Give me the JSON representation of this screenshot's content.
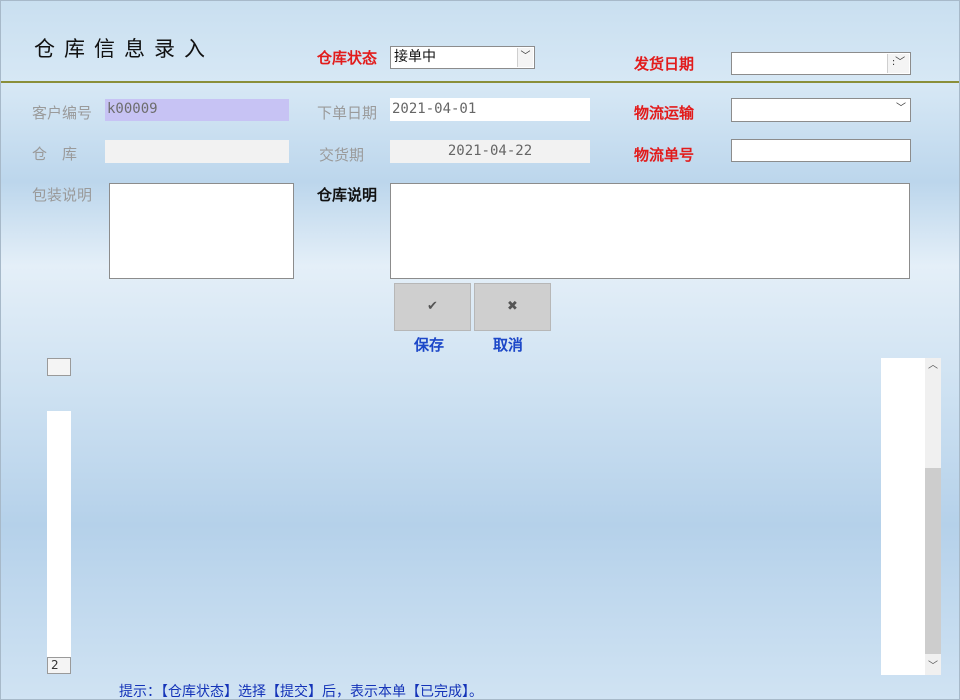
{
  "header": {
    "title": "仓库信息录入"
  },
  "top": {
    "status_label": "仓库状态",
    "status_value": "接单中",
    "ship_date_label": "发货日期",
    "ship_date_value": ""
  },
  "form": {
    "customer_no_label": "客户编号",
    "customer_no_value": "k00009",
    "order_date_label": "下单日期",
    "order_date_value": "2021-04-01",
    "logistics_label": "物流运输",
    "logistics_value": "",
    "warehouse_label": "仓　库",
    "warehouse_value": "",
    "delivery_label": "交货期",
    "delivery_value": "2021-04-22",
    "tracking_label": "物流单号",
    "tracking_value": "",
    "packaging_label": "包装说明",
    "warehouse_note_label": "仓库说明"
  },
  "actions": {
    "save_symbol": "✔",
    "save_label": "保存",
    "cancel_symbol": "✖",
    "cancel_label": "取消"
  },
  "side": {
    "record_index": "2"
  },
  "footer": {
    "hint": "提示：【仓库状态】选择【提交】后，表示本单【已完成】。"
  },
  "icons": {
    "dropdown": "chevron-down-icon",
    "scroll_up": "chevron-up-icon",
    "scroll_down": "chevron-down-icon"
  },
  "colors": {
    "required_label": "#e21b1b",
    "button_label": "#1c47c8",
    "customer_field": "#c7c3f4",
    "divider": "#8a8f3a"
  }
}
